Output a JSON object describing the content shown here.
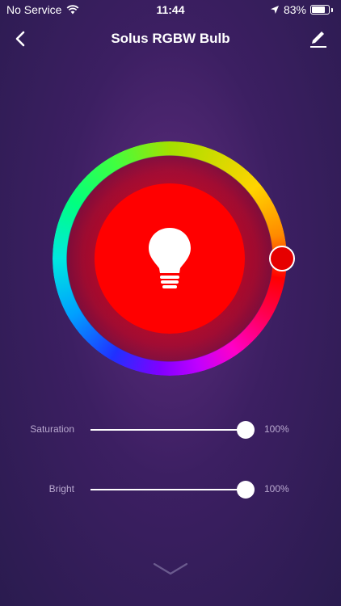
{
  "status_bar": {
    "carrier": "No Service",
    "time": "11:44",
    "battery_percent": "83%",
    "battery_level": 0.83,
    "icons": [
      "wifi-icon",
      "location-arrow-icon",
      "battery-icon"
    ]
  },
  "nav": {
    "title": "Solus RGBW Bulb",
    "back_icon": "chevron-left-icon",
    "edit_icon": "pencil-icon"
  },
  "color_wheel": {
    "selected_color": "#ff0000",
    "center_icon": "lightbulb-icon"
  },
  "sliders": [
    {
      "label": "Saturation",
      "value_text": "100%",
      "value": 100
    },
    {
      "label": "Bright",
      "value_text": "100%",
      "value": 100
    }
  ],
  "footer": {
    "expand_icon": "chevron-down-icon"
  },
  "colors": {
    "background": "#3c1f62",
    "selected": "#ff0000",
    "label_text": "#b9a9cf"
  }
}
